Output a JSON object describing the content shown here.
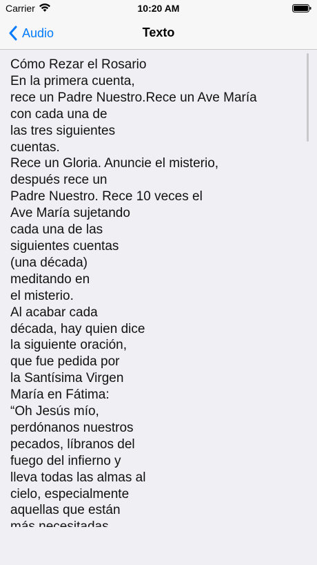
{
  "status_bar": {
    "carrier": "Carrier",
    "time": "10:20 AM"
  },
  "nav": {
    "back_label": "Audio",
    "title": "Texto"
  },
  "text_body": "Cómo Rezar el Rosario\nEn la primera cuenta,\nrece un Padre Nuestro.Rece un Ave María\ncon cada una de\nlas tres siguientes\ncuentas.\nRece un Gloria. Anuncie el misterio,\ndespués rece un\nPadre Nuestro. Rece 10 veces el\nAve María sujetando\ncada una de las\nsiguientes cuentas\n(una década)\nmeditando en\nel misterio.\nAl acabar cada\ndécada, hay quien dice\nla siguiente oración,\nque fue pedida por\nla Santísima Virgen\nMaría en Fátima:\n“Oh Jesús mío,\nperdónanos nuestros\npecados, líbranos del\nfuego del infierno y\nlleva todas las almas al\ncielo, especialmente\naquellas que están\nmás necesitadas"
}
